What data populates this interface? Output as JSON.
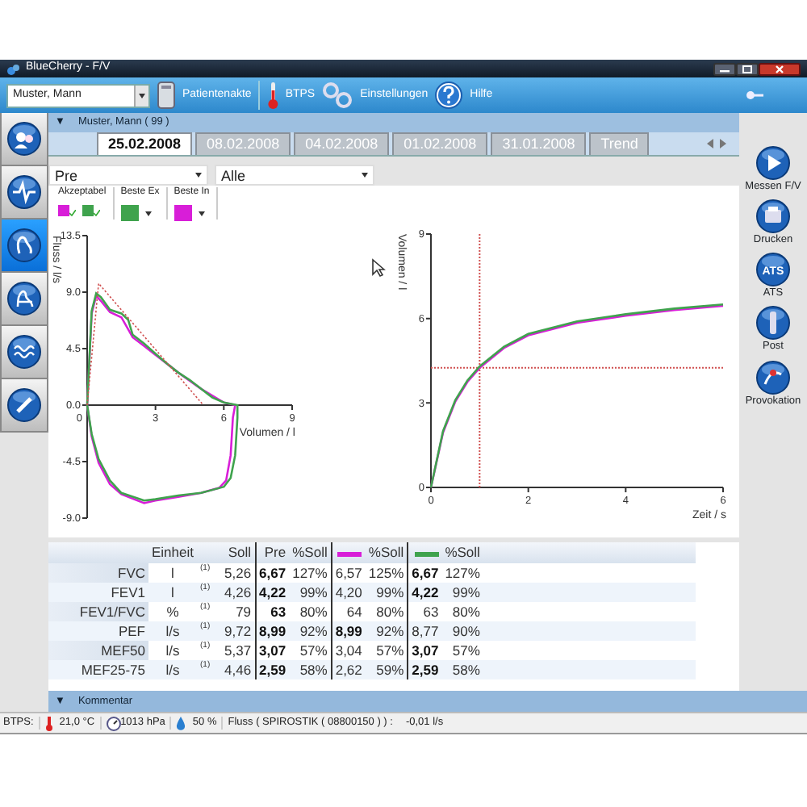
{
  "window": {
    "title": "BlueCherry - F/V"
  },
  "toolbar": {
    "patient_select": {
      "value": "Muster, Mann"
    },
    "buttons": [
      {
        "label": "Patientenakte"
      },
      {
        "label": "BTPS"
      },
      {
        "label": "Einstellungen"
      },
      {
        "label": "Hilfe"
      }
    ]
  },
  "sidebar": {
    "items": [
      {
        "selected": false
      },
      {
        "selected": false
      },
      {
        "selected": true
      },
      {
        "selected": false
      },
      {
        "selected": false
      },
      {
        "selected": false
      }
    ]
  },
  "patient_header": {
    "toggle": "▼",
    "text": "Muster, Mann ( 99 )"
  },
  "tabs": [
    {
      "label": "25.02.2008",
      "selected": true
    },
    {
      "label": "08.02.2008",
      "selected": false
    },
    {
      "label": "04.02.2008",
      "selected": false
    },
    {
      "label": "01.02.2008",
      "selected": false
    },
    {
      "label": "31.01.2008",
      "selected": false
    },
    {
      "label": "Trend",
      "selected": false
    }
  ],
  "filters": [
    {
      "value": "Pre"
    },
    {
      "value": "Alle"
    }
  ],
  "legend": [
    {
      "kind": "check",
      "label": "Akzeptabel",
      "swatches": [
        {
          "color": "#d81ed8",
          "checked": true
        },
        {
          "color": "#3fa34d",
          "checked": true
        }
      ]
    },
    {
      "kind": "pick",
      "label": "Beste Ex",
      "swatches": [
        {
          "color": "#3fa34d"
        }
      ]
    },
    {
      "kind": "pick",
      "label": "Beste In",
      "swatches": [
        {
          "color": "#d81ed8"
        }
      ]
    }
  ],
  "flow_volume": {
    "xlabel": "Volumen / l",
    "ylabel": "Fluss / l/s",
    "xticks": [
      "0",
      "3",
      "6",
      "9"
    ],
    "yticks": [
      "13.5",
      "9.0",
      "4.5",
      "0.0",
      "-4.5",
      "-9.0"
    ]
  },
  "volume_time": {
    "chart_data": {
      "type": "line",
      "xlabel": "Zeit / s",
      "ylabel": "Volumen / l",
      "xlim": [
        0,
        6
      ],
      "ylim": [
        0,
        9
      ],
      "xticks": [
        0,
        2,
        4,
        6
      ],
      "yticks": [
        0,
        3,
        6,
        9
      ],
      "series": [
        {
          "color": "#d81ed8",
          "x": [
            0,
            0.25,
            0.5,
            0.75,
            1,
            1.5,
            2,
            3,
            4,
            5,
            6
          ],
          "values": [
            0,
            1.95,
            3.05,
            3.75,
            4.25,
            4.95,
            5.4,
            5.85,
            6.1,
            6.3,
            6.45
          ]
        },
        {
          "color": "#3fa34d",
          "x": [
            0,
            0.25,
            0.5,
            0.75,
            1,
            1.5,
            2,
            3,
            4,
            5,
            6
          ],
          "values": [
            0,
            2,
            3.1,
            3.8,
            4.3,
            5,
            5.45,
            5.9,
            6.15,
            6.35,
            6.5
          ]
        }
      ],
      "ref_lines": [
        {
          "axis": "x",
          "value": 1,
          "color": "#d05050",
          "line_style": "dashed"
        },
        {
          "axis": "y",
          "value": 4.25,
          "color": "#d05050",
          "line_style": "dashed"
        }
      ]
    }
  },
  "actions": [
    {
      "label": "Messen F/V"
    },
    {
      "label": "Drucken"
    },
    {
      "label": "ATS",
      "icon_text": "ATS"
    },
    {
      "label": "Post"
    },
    {
      "label": "Provokation"
    }
  ],
  "results_table": {
    "columns": [
      {
        "kind": "blank"
      },
      {
        "kind": "text",
        "label": "Einheit"
      },
      {
        "kind": "blank"
      },
      {
        "kind": "text",
        "label": "Soll"
      },
      {
        "kind": "text",
        "label": "Pre"
      },
      {
        "kind": "text",
        "label": "%Soll"
      },
      {
        "kind": "swatch",
        "color": "#d81ed8"
      },
      {
        "kind": "text",
        "label": "%Soll"
      },
      {
        "kind": "swatch",
        "color": "#3fa34d"
      },
      {
        "kind": "text",
        "label": "%Soll"
      }
    ],
    "rows": [
      {
        "name": "FVC",
        "unit": "l",
        "note": "(1)",
        "predicted": "5,26",
        "results": [
          {
            "value": "6,67",
            "bold": true,
            "percent": "127%"
          },
          {
            "value": "6,57",
            "bold": false,
            "percent": "125%"
          },
          {
            "value": "6,67",
            "bold": true,
            "percent": "127%"
          }
        ]
      },
      {
        "name": "FEV1",
        "unit": "l",
        "note": "(1)",
        "predicted": "4,26",
        "results": [
          {
            "value": "4,22",
            "bold": true,
            "percent": "99%"
          },
          {
            "value": "4,20",
            "bold": false,
            "percent": "99%"
          },
          {
            "value": "4,22",
            "bold": true,
            "percent": "99%"
          }
        ]
      },
      {
        "name": "FEV1/FVC",
        "unit": "%",
        "note": "(1)",
        "predicted": "79",
        "results": [
          {
            "value": "63",
            "bold": true,
            "percent": "80%"
          },
          {
            "value": "64",
            "bold": false,
            "percent": "80%"
          },
          {
            "value": "63",
            "bold": false,
            "percent": "80%"
          }
        ]
      },
      {
        "name": "PEF",
        "unit": "l/s",
        "note": "(1)",
        "predicted": "9,72",
        "results": [
          {
            "value": "8,99",
            "bold": true,
            "percent": "92%"
          },
          {
            "value": "8,99",
            "bold": true,
            "percent": "92%"
          },
          {
            "value": "8,77",
            "bold": false,
            "percent": "90%"
          }
        ]
      },
      {
        "name": "MEF50",
        "unit": "l/s",
        "note": "(1)",
        "predicted": "5,37",
        "results": [
          {
            "value": "3,07",
            "bold": true,
            "percent": "57%"
          },
          {
            "value": "3,04",
            "bold": false,
            "percent": "57%"
          },
          {
            "value": "3,07",
            "bold": true,
            "percent": "57%"
          }
        ]
      },
      {
        "name": "MEF25-75",
        "unit": "l/s",
        "note": "(1)",
        "predicted": "4,46",
        "results": [
          {
            "value": "2,59",
            "bold": true,
            "percent": "58%"
          },
          {
            "value": "2,62",
            "bold": false,
            "percent": "59%"
          },
          {
            "value": "2,59",
            "bold": true,
            "percent": "58%"
          }
        ]
      }
    ]
  },
  "comment_bar": {
    "toggle": "▼",
    "label": "Kommentar"
  },
  "status_bar": {
    "label": "BTPS:",
    "temperature": "21,0 °C",
    "pressure": "1013 hPa",
    "humidity": "50 %",
    "sensor": "Fluss ( SPIROSTIK ( 08800150 ) ) :",
    "flow": "-0,01 l/s"
  }
}
